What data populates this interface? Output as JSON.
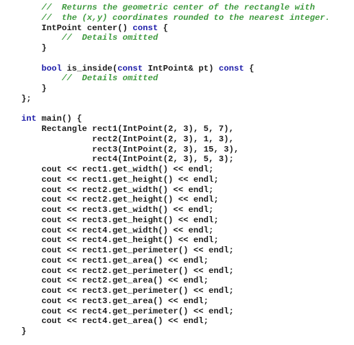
{
  "document": {
    "language": "cpp",
    "lines": [
      [
        {
          "t": "cm",
          "s": "    //  Returns the geometric center of the rectangle with"
        }
      ],
      [
        {
          "t": "cm",
          "s": "    //  the (x,y) coordinates rounded to the nearest integer."
        }
      ],
      [
        {
          "t": "tx",
          "s": "    IntPoint center() "
        },
        {
          "t": "kw",
          "s": "const"
        },
        {
          "t": "tx",
          "s": " {"
        }
      ],
      [
        {
          "t": "cm",
          "s": "        //  Details omitted"
        }
      ],
      [
        {
          "t": "tx",
          "s": "    }"
        }
      ],
      [
        {
          "t": "tx",
          "s": ""
        }
      ],
      [
        {
          "t": "kw",
          "s": "    bool"
        },
        {
          "t": "tx",
          "s": " is_inside("
        },
        {
          "t": "kw",
          "s": "const"
        },
        {
          "t": "tx",
          "s": " IntPoint& pt) "
        },
        {
          "t": "kw",
          "s": "const"
        },
        {
          "t": "tx",
          "s": " {"
        }
      ],
      [
        {
          "t": "cm",
          "s": "        //  Details omitted"
        }
      ],
      [
        {
          "t": "tx",
          "s": "    }"
        }
      ],
      [
        {
          "t": "tx",
          "s": "};"
        }
      ],
      [
        {
          "t": "tx",
          "s": ""
        }
      ],
      [
        {
          "t": "kw",
          "s": "int"
        },
        {
          "t": "tx",
          "s": " main() {"
        }
      ],
      [
        {
          "t": "tx",
          "s": "    Rectangle rect1(IntPoint(2, 3), 5, 7),"
        }
      ],
      [
        {
          "t": "tx",
          "s": "              rect2(IntPoint(2, 3), 1, 3),"
        }
      ],
      [
        {
          "t": "tx",
          "s": "              rect3(IntPoint(2, 3), 15, 3),"
        }
      ],
      [
        {
          "t": "tx",
          "s": "              rect4(IntPoint(2, 3), 5, 3);"
        }
      ],
      [
        {
          "t": "tx",
          "s": "    cout << rect1.get_width() << endl;"
        }
      ],
      [
        {
          "t": "tx",
          "s": "    cout << rect1.get_height() << endl;"
        }
      ],
      [
        {
          "t": "tx",
          "s": "    cout << rect2.get_width() << endl;"
        }
      ],
      [
        {
          "t": "tx",
          "s": "    cout << rect2.get_height() << endl;"
        }
      ],
      [
        {
          "t": "tx",
          "s": "    cout << rect3.get_width() << endl;"
        }
      ],
      [
        {
          "t": "tx",
          "s": "    cout << rect3.get_height() << endl;"
        }
      ],
      [
        {
          "t": "tx",
          "s": "    cout << rect4.get_width() << endl;"
        }
      ],
      [
        {
          "t": "tx",
          "s": "    cout << rect4.get_height() << endl;"
        }
      ],
      [
        {
          "t": "tx",
          "s": "    cout << rect1.get_perimeter() << endl;"
        }
      ],
      [
        {
          "t": "tx",
          "s": "    cout << rect1.get_area() << endl;"
        }
      ],
      [
        {
          "t": "tx",
          "s": "    cout << rect2.get_perimeter() << endl;"
        }
      ],
      [
        {
          "t": "tx",
          "s": "    cout << rect2.get_area() << endl;"
        }
      ],
      [
        {
          "t": "tx",
          "s": "    cout << rect3.get_perimeter() << endl;"
        }
      ],
      [
        {
          "t": "tx",
          "s": "    cout << rect3.get_area() << endl;"
        }
      ],
      [
        {
          "t": "tx",
          "s": "    cout << rect4.get_perimeter() << endl;"
        }
      ],
      [
        {
          "t": "tx",
          "s": "    cout << rect4.get_area() << endl;"
        }
      ],
      [
        {
          "t": "tx",
          "s": "}"
        }
      ]
    ]
  },
  "colors": {
    "comment": "#3f9a3f",
    "keyword": "#1b1ba8",
    "text": "#1c1c1c",
    "background": "#ffffff"
  }
}
